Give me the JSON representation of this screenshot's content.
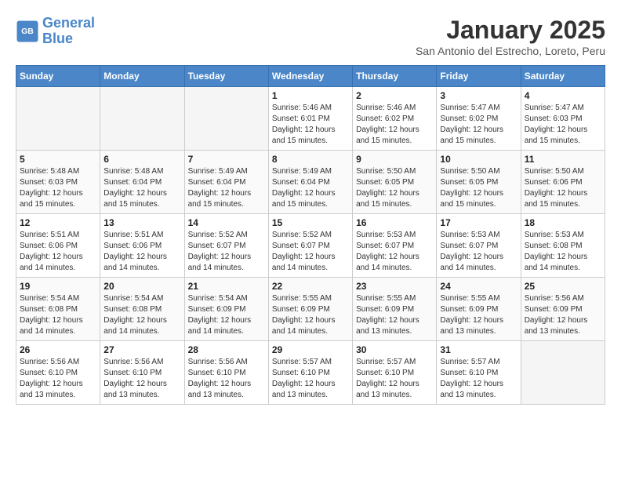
{
  "header": {
    "logo_line1": "General",
    "logo_line2": "Blue",
    "title": "January 2025",
    "subtitle": "San Antonio del Estrecho, Loreto, Peru"
  },
  "columns": [
    "Sunday",
    "Monday",
    "Tuesday",
    "Wednesday",
    "Thursday",
    "Friday",
    "Saturday"
  ],
  "weeks": [
    [
      {
        "day": "",
        "info": ""
      },
      {
        "day": "",
        "info": ""
      },
      {
        "day": "",
        "info": ""
      },
      {
        "day": "1",
        "info": "Sunrise: 5:46 AM\nSunset: 6:01 PM\nDaylight: 12 hours\nand 15 minutes."
      },
      {
        "day": "2",
        "info": "Sunrise: 5:46 AM\nSunset: 6:02 PM\nDaylight: 12 hours\nand 15 minutes."
      },
      {
        "day": "3",
        "info": "Sunrise: 5:47 AM\nSunset: 6:02 PM\nDaylight: 12 hours\nand 15 minutes."
      },
      {
        "day": "4",
        "info": "Sunrise: 5:47 AM\nSunset: 6:03 PM\nDaylight: 12 hours\nand 15 minutes."
      }
    ],
    [
      {
        "day": "5",
        "info": "Sunrise: 5:48 AM\nSunset: 6:03 PM\nDaylight: 12 hours\nand 15 minutes."
      },
      {
        "day": "6",
        "info": "Sunrise: 5:48 AM\nSunset: 6:04 PM\nDaylight: 12 hours\nand 15 minutes."
      },
      {
        "day": "7",
        "info": "Sunrise: 5:49 AM\nSunset: 6:04 PM\nDaylight: 12 hours\nand 15 minutes."
      },
      {
        "day": "8",
        "info": "Sunrise: 5:49 AM\nSunset: 6:04 PM\nDaylight: 12 hours\nand 15 minutes."
      },
      {
        "day": "9",
        "info": "Sunrise: 5:50 AM\nSunset: 6:05 PM\nDaylight: 12 hours\nand 15 minutes."
      },
      {
        "day": "10",
        "info": "Sunrise: 5:50 AM\nSunset: 6:05 PM\nDaylight: 12 hours\nand 15 minutes."
      },
      {
        "day": "11",
        "info": "Sunrise: 5:50 AM\nSunset: 6:06 PM\nDaylight: 12 hours\nand 15 minutes."
      }
    ],
    [
      {
        "day": "12",
        "info": "Sunrise: 5:51 AM\nSunset: 6:06 PM\nDaylight: 12 hours\nand 14 minutes."
      },
      {
        "day": "13",
        "info": "Sunrise: 5:51 AM\nSunset: 6:06 PM\nDaylight: 12 hours\nand 14 minutes."
      },
      {
        "day": "14",
        "info": "Sunrise: 5:52 AM\nSunset: 6:07 PM\nDaylight: 12 hours\nand 14 minutes."
      },
      {
        "day": "15",
        "info": "Sunrise: 5:52 AM\nSunset: 6:07 PM\nDaylight: 12 hours\nand 14 minutes."
      },
      {
        "day": "16",
        "info": "Sunrise: 5:53 AM\nSunset: 6:07 PM\nDaylight: 12 hours\nand 14 minutes."
      },
      {
        "day": "17",
        "info": "Sunrise: 5:53 AM\nSunset: 6:07 PM\nDaylight: 12 hours\nand 14 minutes."
      },
      {
        "day": "18",
        "info": "Sunrise: 5:53 AM\nSunset: 6:08 PM\nDaylight: 12 hours\nand 14 minutes."
      }
    ],
    [
      {
        "day": "19",
        "info": "Sunrise: 5:54 AM\nSunset: 6:08 PM\nDaylight: 12 hours\nand 14 minutes."
      },
      {
        "day": "20",
        "info": "Sunrise: 5:54 AM\nSunset: 6:08 PM\nDaylight: 12 hours\nand 14 minutes."
      },
      {
        "day": "21",
        "info": "Sunrise: 5:54 AM\nSunset: 6:09 PM\nDaylight: 12 hours\nand 14 minutes."
      },
      {
        "day": "22",
        "info": "Sunrise: 5:55 AM\nSunset: 6:09 PM\nDaylight: 12 hours\nand 14 minutes."
      },
      {
        "day": "23",
        "info": "Sunrise: 5:55 AM\nSunset: 6:09 PM\nDaylight: 12 hours\nand 13 minutes."
      },
      {
        "day": "24",
        "info": "Sunrise: 5:55 AM\nSunset: 6:09 PM\nDaylight: 12 hours\nand 13 minutes."
      },
      {
        "day": "25",
        "info": "Sunrise: 5:56 AM\nSunset: 6:09 PM\nDaylight: 12 hours\nand 13 minutes."
      }
    ],
    [
      {
        "day": "26",
        "info": "Sunrise: 5:56 AM\nSunset: 6:10 PM\nDaylight: 12 hours\nand 13 minutes."
      },
      {
        "day": "27",
        "info": "Sunrise: 5:56 AM\nSunset: 6:10 PM\nDaylight: 12 hours\nand 13 minutes."
      },
      {
        "day": "28",
        "info": "Sunrise: 5:56 AM\nSunset: 6:10 PM\nDaylight: 12 hours\nand 13 minutes."
      },
      {
        "day": "29",
        "info": "Sunrise: 5:57 AM\nSunset: 6:10 PM\nDaylight: 12 hours\nand 13 minutes."
      },
      {
        "day": "30",
        "info": "Sunrise: 5:57 AM\nSunset: 6:10 PM\nDaylight: 12 hours\nand 13 minutes."
      },
      {
        "day": "31",
        "info": "Sunrise: 5:57 AM\nSunset: 6:10 PM\nDaylight: 12 hours\nand 13 minutes."
      },
      {
        "day": "",
        "info": ""
      }
    ]
  ]
}
